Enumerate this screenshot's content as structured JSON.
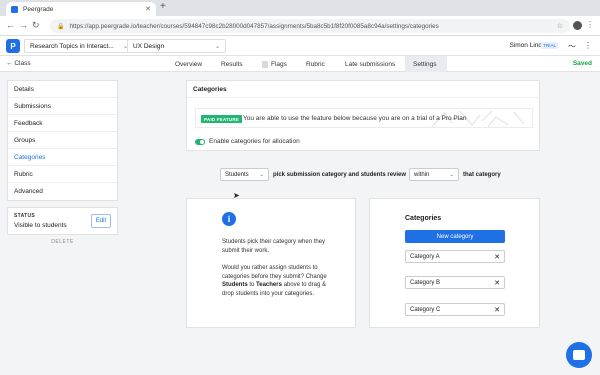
{
  "browser": {
    "tab_title": "Peergrade",
    "url": "https://app.peergrade.io/teacher/courses/594847c98c2b28000d047857/assignments/5ba8c5b1f8f20f0085a8c94a/settings/categories"
  },
  "header": {
    "logo": "P",
    "course": "Research Topics in Interact...",
    "assignment": "UX Design",
    "user_name": "Simon Lind",
    "trial_badge": "TRIAL"
  },
  "subnav": {
    "back": "Class",
    "tabs": [
      "Overview",
      "Results",
      "Flags",
      "Rubric",
      "Late submissions",
      "Settings"
    ],
    "saved": "Saved"
  },
  "sidebar": {
    "items": [
      "Details",
      "Submissions",
      "Feedback",
      "Groups",
      "Categories",
      "Rubric",
      "Advanced"
    ],
    "active": "Categories"
  },
  "status": {
    "label": "STATUS",
    "value": "Visible to students",
    "edit": "Edit",
    "delete": "DELETE"
  },
  "categories_card": {
    "title": "Categories",
    "badge": "PAID FEATURE",
    "promo": "You are able to use the feature below because you are on a trial of a Pro Plan",
    "toggle_label": "Enable categories for allocation",
    "toggle_on": true
  },
  "controls": {
    "who": "Students",
    "middle_text": "pick submission category and students review",
    "scope": "within",
    "end_text": "that category"
  },
  "info": {
    "p1": "Students pick their category when they submit their work.",
    "p2_a": "Would you rather assign students to categories before they submit? Change ",
    "p2_b1": "Students",
    "p2_c": " to ",
    "p2_b2": "Teachers",
    "p2_d": " above to drag & drop students into your categories."
  },
  "category_list": {
    "title": "Categories",
    "new_button": "New category",
    "items": [
      "Category A",
      "Category B",
      "Category C"
    ]
  },
  "colors": {
    "accent": "#1f6fe5",
    "success": "#22b573"
  }
}
